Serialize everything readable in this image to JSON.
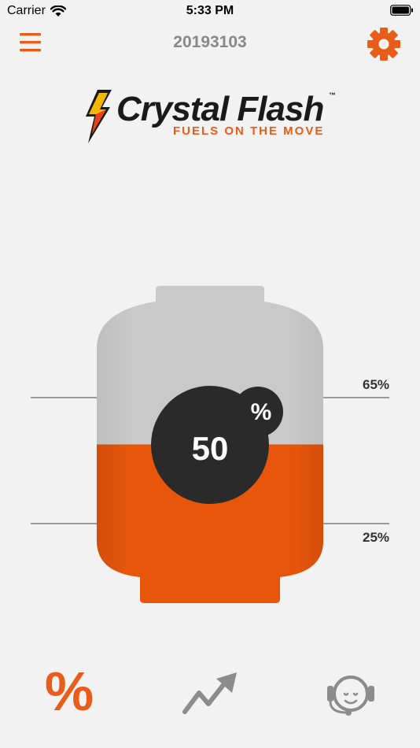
{
  "status_bar": {
    "carrier": "Carrier",
    "time": "5:33 PM"
  },
  "nav": {
    "title": "20193103"
  },
  "logo": {
    "name": "Crystal Flash",
    "tm": "™",
    "tagline": "FUELS ON THE MOVE"
  },
  "tank": {
    "level_percent": 50,
    "level_value": "50",
    "unit": "%",
    "upper_threshold_label": "65%",
    "upper_threshold": 65,
    "lower_threshold_label": "25%",
    "lower_threshold": 25
  },
  "tabs": [
    {
      "icon": "percent-icon",
      "label": "%",
      "active": true
    },
    {
      "icon": "trend-chart-icon",
      "active": false
    },
    {
      "icon": "headset-support-icon",
      "active": false
    }
  ],
  "colors": {
    "accent": "#e85d1a",
    "fuel": "#e8560c",
    "tank_empty": "#c6c6c6",
    "badge": "#2a2a2a",
    "background": "#f2f2f2",
    "inactive_icon": "#8c8c8c"
  }
}
